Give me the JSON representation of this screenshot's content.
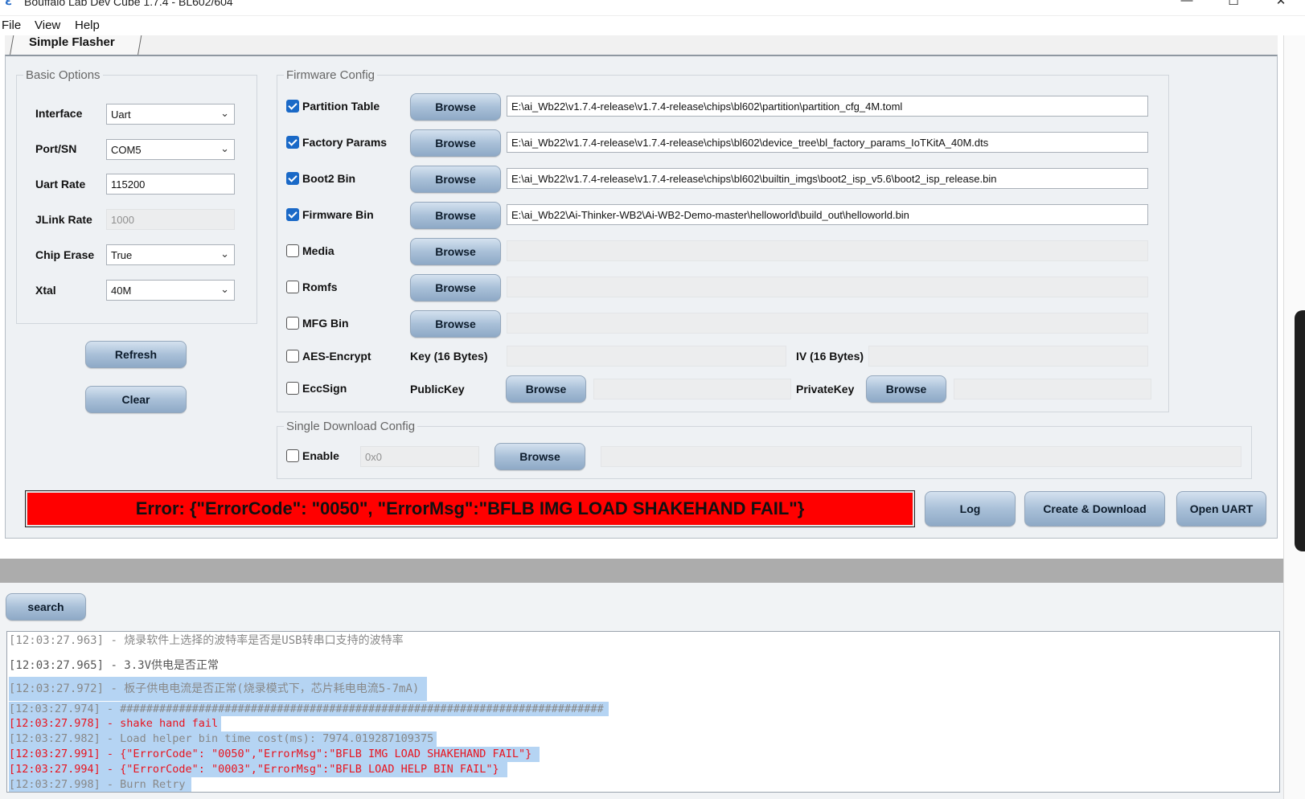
{
  "window": {
    "title": "Bouffalo Lab Dev Cube 1.7.4 - BL602/604",
    "minimize": "—",
    "maximize": "☐",
    "close": "✕"
  },
  "menu": [
    "File",
    "View",
    "Help"
  ],
  "tab": {
    "label": "Simple Flasher"
  },
  "basic_options": {
    "legend": "Basic Options",
    "interface": {
      "label": "Interface",
      "value": "Uart"
    },
    "port": {
      "label": "Port/SN",
      "value": "COM5"
    },
    "uart_rate": {
      "label": "Uart Rate",
      "value": "115200"
    },
    "jlink_rate": {
      "label": "JLink Rate",
      "value": "1000"
    },
    "chip_erase": {
      "label": "Chip Erase",
      "value": "True"
    },
    "xtal": {
      "label": "Xtal",
      "value": "40M"
    },
    "refresh": "Refresh",
    "clear": "Clear"
  },
  "firmware_config": {
    "legend": "Firmware Config",
    "browse_label": "Browse",
    "rows": [
      {
        "label": "Partition Table",
        "checked": true,
        "path": "E:\\ai_Wb22\\v1.7.4-release\\v1.7.4-release\\chips\\bl602\\partition\\partition_cfg_4M.toml"
      },
      {
        "label": "Factory Params",
        "checked": true,
        "path": "E:\\ai_Wb22\\v1.7.4-release\\v1.7.4-release\\chips\\bl602\\device_tree\\bl_factory_params_IoTKitA_40M.dts"
      },
      {
        "label": "Boot2 Bin",
        "checked": true,
        "path": "E:\\ai_Wb22\\v1.7.4-release\\v1.7.4-release\\chips\\bl602\\builtin_imgs\\boot2_isp_v5.6\\boot2_isp_release.bin"
      },
      {
        "label": "Firmware Bin",
        "checked": true,
        "path": "E:\\ai_Wb22\\Ai-Thinker-WB2\\Ai-WB2-Demo-master\\helloworld\\build_out\\helloworld.bin"
      },
      {
        "label": "Media",
        "checked": false,
        "path": ""
      },
      {
        "label": "Romfs",
        "checked": false,
        "path": ""
      },
      {
        "label": "MFG Bin",
        "checked": false,
        "path": ""
      }
    ],
    "aes": {
      "label": "AES-Encrypt",
      "key_label": "Key (16 Bytes)",
      "iv_label": "IV (16 Bytes)"
    },
    "ecc": {
      "label": "EccSign",
      "public_label": "PublicKey",
      "private_label": "PrivateKey"
    }
  },
  "single_download": {
    "legend": "Single Download Config",
    "enable_label": "Enable",
    "address": "0x0",
    "browse_label": "Browse"
  },
  "status": {
    "error_text": "Error: {\"ErrorCode\": \"0050\", \"ErrorMsg\":\"BFLB IMG LOAD SHAKEHAND FAIL\"}",
    "error_color": "#ff0000"
  },
  "actions": {
    "log": "Log",
    "create_download": "Create & Download",
    "open_uart": "Open UART"
  },
  "search_button": "search",
  "log_lines": [
    {
      "time": "[12:03:27.963]",
      "text": " - 烧录软件上选择的波特率是否是USB转串口支持的波特率"
    },
    {
      "time": "[12:03:27.965]",
      "text": " - 3.3V供电是否正常"
    },
    {
      "time": "[12:03:27.972]",
      "text": " - 板子供电电流是否正常(烧录模式下，芯片耗电电流5-7mA)"
    },
    {
      "time": "[12:03:27.974]",
      "text": " - ##########################################################################"
    },
    {
      "time": "[12:03:27.978]",
      "text": " - shake hand fail"
    },
    {
      "time": "[12:03:27.982]",
      "text": " - Load helper bin time cost(ms): 7974.019287109375"
    },
    {
      "time": "[12:03:27.991]",
      "text": " - {\"ErrorCode\": \"0050\",\"ErrorMsg\":\"BFLB IMG LOAD SHAKEHAND FAIL\"}"
    },
    {
      "time": "[12:03:27.994]",
      "text": " - {\"ErrorCode\": \"0003\",\"ErrorMsg\":\"BFLB LOAD HELP BIN FAIL\"}"
    },
    {
      "time": "[12:03:27.998]",
      "text": " - Burn Retry"
    }
  ]
}
